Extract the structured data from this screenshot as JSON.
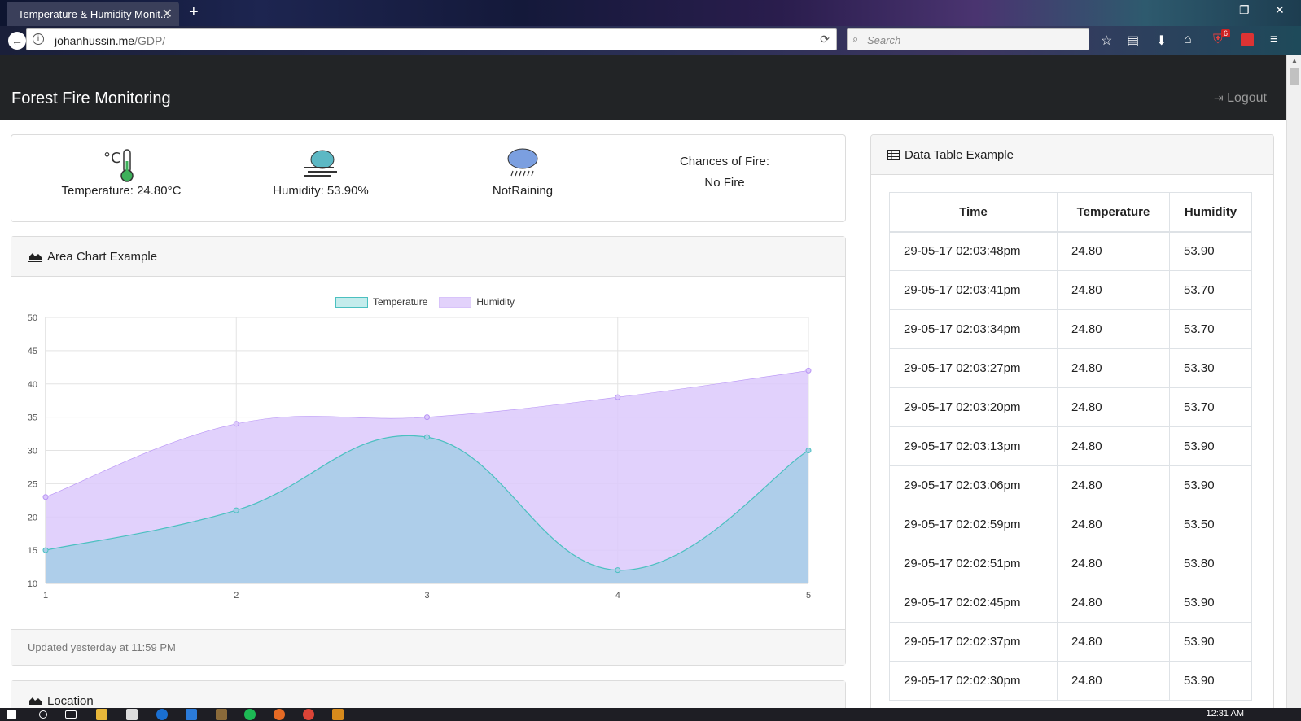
{
  "browser": {
    "tab_title": "Temperature & Humidity Monit...",
    "url_domain": "johanhussin.me",
    "url_path": "/GDP/",
    "search_placeholder": "Search",
    "badge_count": "6",
    "clock": "12:31 AM"
  },
  "app": {
    "brand": "Forest Fire Monitoring",
    "logout_label": "Logout"
  },
  "stats": {
    "temperature": "Temperature: 24.80°C",
    "humidity": "Humidity: 53.90%",
    "rain": "NotRaining",
    "fire_label": "Chances of Fire:",
    "fire_value": "No Fire"
  },
  "area_card": {
    "title": "Area Chart Example",
    "footer": "Updated yesterday at 11:59 PM"
  },
  "location_card": {
    "title": "Location"
  },
  "table_card": {
    "title": "Data Table Example",
    "columns": [
      "Time",
      "Temperature",
      "Humidity"
    ],
    "rows": [
      [
        "29-05-17 02:03:48pm",
        "24.80",
        "53.90"
      ],
      [
        "29-05-17 02:03:41pm",
        "24.80",
        "53.70"
      ],
      [
        "29-05-17 02:03:34pm",
        "24.80",
        "53.70"
      ],
      [
        "29-05-17 02:03:27pm",
        "24.80",
        "53.30"
      ],
      [
        "29-05-17 02:03:20pm",
        "24.80",
        "53.70"
      ],
      [
        "29-05-17 02:03:13pm",
        "24.80",
        "53.90"
      ],
      [
        "29-05-17 02:03:06pm",
        "24.80",
        "53.90"
      ],
      [
        "29-05-17 02:02:59pm",
        "24.80",
        "53.50"
      ],
      [
        "29-05-17 02:02:51pm",
        "24.80",
        "53.80"
      ],
      [
        "29-05-17 02:02:45pm",
        "24.80",
        "53.90"
      ],
      [
        "29-05-17 02:02:37pm",
        "24.80",
        "53.90"
      ],
      [
        "29-05-17 02:02:30pm",
        "24.80",
        "53.90"
      ]
    ]
  },
  "colors": {
    "temperature_fill": "#a8cde8",
    "temperature_line": "#4bc0c0",
    "humidity_fill": "#dcc9fb",
    "humidity_line": "#b894f5",
    "navbar": "#222426"
  },
  "chart_data": {
    "type": "area",
    "x": [
      1,
      2,
      3,
      4,
      5
    ],
    "series": [
      {
        "name": "Temperature",
        "values": [
          15,
          21,
          32,
          12,
          30
        ]
      },
      {
        "name": "Humidity",
        "values": [
          23,
          34,
          35,
          38,
          42
        ]
      }
    ],
    "ylim": [
      10,
      50
    ],
    "yticks": [
      10,
      15,
      20,
      25,
      30,
      35,
      40,
      45,
      50
    ],
    "xticks": [
      "1",
      "2",
      "3",
      "4",
      "5"
    ],
    "grid": true,
    "legend": "top-center"
  }
}
